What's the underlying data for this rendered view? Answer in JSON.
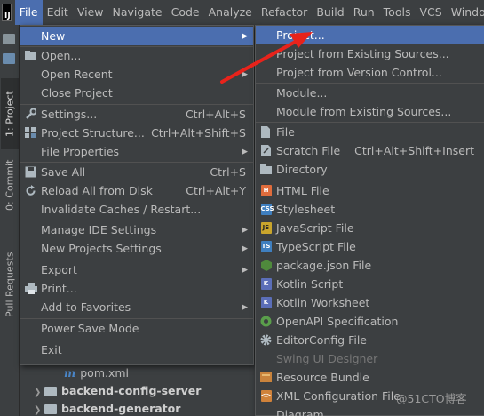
{
  "menubar": {
    "items": [
      {
        "label": "File",
        "mnemonic": "F",
        "active": true
      },
      {
        "label": "Edit",
        "mnemonic": "E"
      },
      {
        "label": "View",
        "mnemonic": "V"
      },
      {
        "label": "Navigate",
        "mnemonic": "N"
      },
      {
        "label": "Code",
        "mnemonic": "C"
      },
      {
        "label": "Analyze",
        "mnemonic": "z"
      },
      {
        "label": "Refactor",
        "mnemonic": "R"
      },
      {
        "label": "Build",
        "mnemonic": "B"
      },
      {
        "label": "Run",
        "mnemonic": "u"
      },
      {
        "label": "Tools",
        "mnemonic": "T"
      },
      {
        "label": "VCS",
        "mnemonic": "S"
      },
      {
        "label": "Windo",
        "mnemonic": "W"
      }
    ]
  },
  "tool_stripe": {
    "project": "1: Project",
    "commit": "0: Commit",
    "pull_requests": "Pull Requests"
  },
  "tree": {
    "pom": "pom.xml",
    "backend_config_server": "backend-config-server",
    "backend_generator": "backend-generator"
  },
  "file_menu": {
    "new": "New",
    "open": "Open...",
    "open_recent": "Open Recent",
    "close_project": "Close Project",
    "settings": "Settings...",
    "settings_sc": "Ctrl+Alt+S",
    "project_structure": "Project Structure...",
    "project_structure_sc": "Ctrl+Alt+Shift+S",
    "file_properties": "File Properties",
    "save_all": "Save All",
    "save_all_sc": "Ctrl+S",
    "reload": "Reload All from Disk",
    "reload_sc": "Ctrl+Alt+Y",
    "invalidate": "Invalidate Caches / Restart...",
    "manage_ide": "Manage IDE Settings",
    "new_projects_settings": "New Projects Settings",
    "export": "Export",
    "print": "Print...",
    "add_favorites": "Add to Favorites",
    "power_save": "Power Save Mode",
    "exit": "Exit"
  },
  "new_menu": {
    "project": "Project...",
    "from_existing": "Project from Existing Sources...",
    "from_vcs": "Project from Version Control...",
    "module": "Module...",
    "module_existing": "Module from Existing Sources...",
    "file": "File",
    "scratch": "Scratch File",
    "scratch_sc": "Ctrl+Alt+Shift+Insert",
    "directory": "Directory",
    "html": "HTML File",
    "stylesheet": "Stylesheet",
    "javascript": "JavaScript File",
    "typescript": "TypeScript File",
    "package_json": "package.json File",
    "kotlin_script": "Kotlin Script",
    "kotlin_worksheet": "Kotlin Worksheet",
    "openapi": "OpenAPI Specification",
    "editorconfig": "EditorConfig File",
    "swing": "Swing UI Designer",
    "resource_bundle": "Resource Bundle",
    "xml_config": "XML Configuration File",
    "diagram": "Diagram"
  },
  "watermark": "@51CTO博客",
  "colors": {
    "background": "#3c3f41",
    "highlight": "#4b6eaf",
    "text": "#bbbbbb",
    "disabled": "#777777",
    "annotation_arrow": "#e8231b"
  }
}
